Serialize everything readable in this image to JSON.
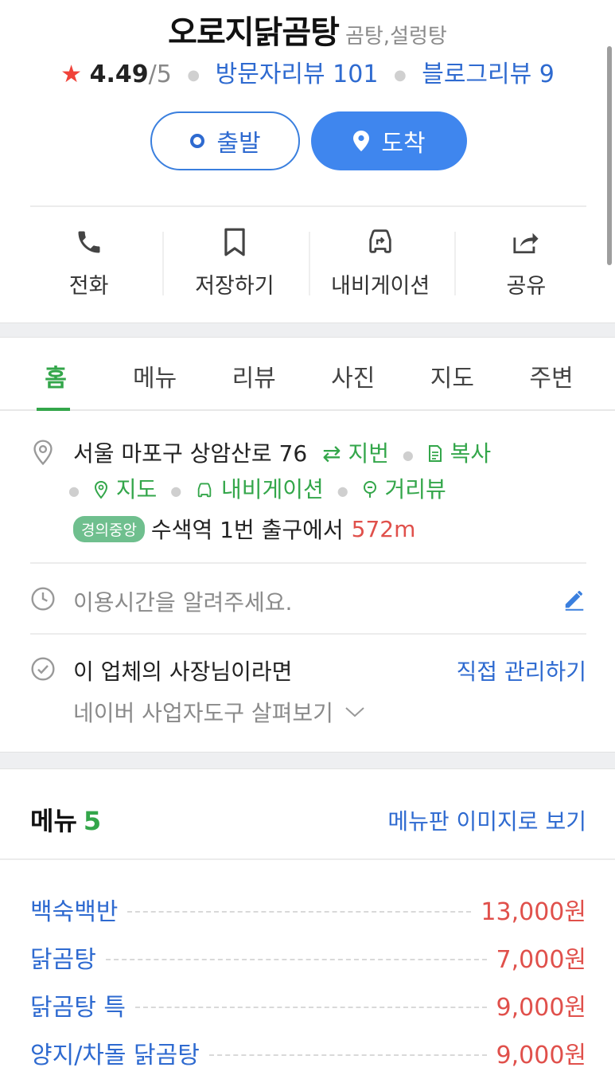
{
  "place": {
    "name": "오로지닭곰탕",
    "category": "곰탕,설렁탕",
    "rating": "4.49",
    "rating_max": "/5",
    "visitor_reviews": "방문자리뷰 101",
    "blog_reviews": "블로그리뷰 9"
  },
  "route_buttons": {
    "depart": "출발",
    "arrive": "도착"
  },
  "actions": {
    "call": "전화",
    "save": "저장하기",
    "navigation": "내비게이션",
    "share": "공유"
  },
  "tabs": [
    "홈",
    "메뉴",
    "리뷰",
    "사진",
    "지도",
    "주변"
  ],
  "address": {
    "road": "서울 마포구 상암산로 76",
    "jibun": "지번",
    "copy": "복사",
    "map": "지도",
    "navigation": "내비게이션",
    "street_view": "거리뷰",
    "line_badge": "경의중앙",
    "station_text": "수색역 1번 출구에서",
    "distance": "572m"
  },
  "hours": {
    "prompt": "이용시간을 알려주세요."
  },
  "owner": {
    "text": "이 업체의 사장님이라면",
    "manage_link": "직접 관리하기",
    "tools": "네이버 사업자도구 살펴보기"
  },
  "menu": {
    "title": "메뉴",
    "count": "5",
    "image_link": "메뉴판 이미지로 보기",
    "items": [
      {
        "name": "백숙백반",
        "price": "13,000원"
      },
      {
        "name": "닭곰탕",
        "price": "7,000원"
      },
      {
        "name": "닭곰탕 특",
        "price": "9,000원"
      },
      {
        "name": "양지/차돌 닭곰탕",
        "price": "9,000원"
      }
    ]
  },
  "colors": {
    "accent_green": "#33a64a",
    "link_blue": "#2e6ad0",
    "button_blue": "#3f86ee",
    "price_red": "#e0504b",
    "star_red": "#f0433a"
  }
}
